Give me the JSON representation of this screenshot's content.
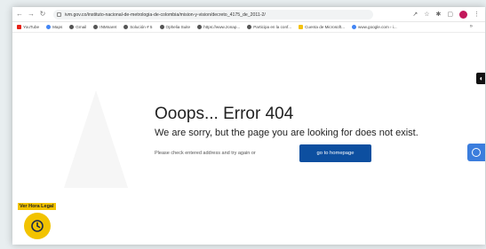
{
  "browser": {
    "url": "ivm.gov.co/instituto-nacional-de-metrologia-de-colombia/mision-y-vision/decreto_4175_de_2011-2/",
    "bookmarks": [
      "YouTube",
      "Maps",
      "Gmail",
      "INMnaret",
      "Solución # 5",
      "Ophelia Suite",
      "https://www.zonap...",
      "Participa en la conf...",
      "Cuenta de Microsoft...",
      "www.google.com › i..."
    ]
  },
  "page": {
    "title": "Ooops... Error 404",
    "subtitle": "We are sorry, but the page you are looking for does not exist.",
    "hint": "Please check entered address and try again or",
    "home_button": "go to homepage",
    "legal_time_label": "Ver Hora Legal"
  },
  "colors": {
    "primary_button": "#0d4fa0",
    "legal_yellow": "#f2c300",
    "accessibility_blue": "#3b7ddd"
  },
  "icons": [
    "back-icon",
    "forward-icon",
    "reload-icon",
    "lock-icon",
    "share-icon",
    "star-icon",
    "extensions-icon",
    "profile-avatar",
    "menu-icon",
    "accessibility-icon",
    "clock-icon"
  ]
}
